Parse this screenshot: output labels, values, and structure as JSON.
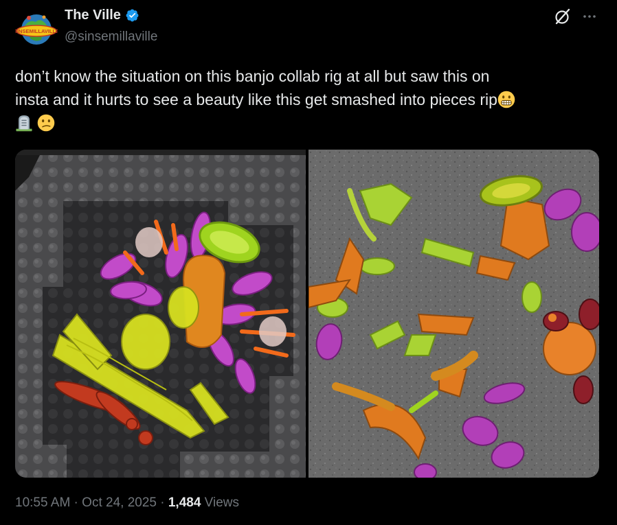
{
  "author": {
    "display_name": "The Ville",
    "handle": "@sinsemillaville",
    "verified": true,
    "avatar_logo_text": "SINSEMILLAVILLE"
  },
  "actions": {
    "grok_icon": "grok-icon",
    "more_icon": "more-icon"
  },
  "tweet": {
    "line1": "don’t know the situation on this banjo collab rig at all but saw this on",
    "line2": "insta and it hurts to see a beauty like this get smashed into pieces rip",
    "emojis": [
      "grimacing-face-emoji",
      "headstone-emoji",
      "confused-face-emoji"
    ]
  },
  "media": {
    "left_image": "intact-glass-rig-in-foam-case",
    "right_image": "smashed-glass-pieces-on-pavement"
  },
  "meta": {
    "time": "10:55 AM",
    "separator": " · ",
    "date": "Oct 24, 2025",
    "views_count": "1,484",
    "views_label": " Views"
  },
  "colors": {
    "background": "#000000",
    "primary_text": "#e7e9ea",
    "secondary_text": "#71767b",
    "verified_blue": "#1d9bf0"
  }
}
